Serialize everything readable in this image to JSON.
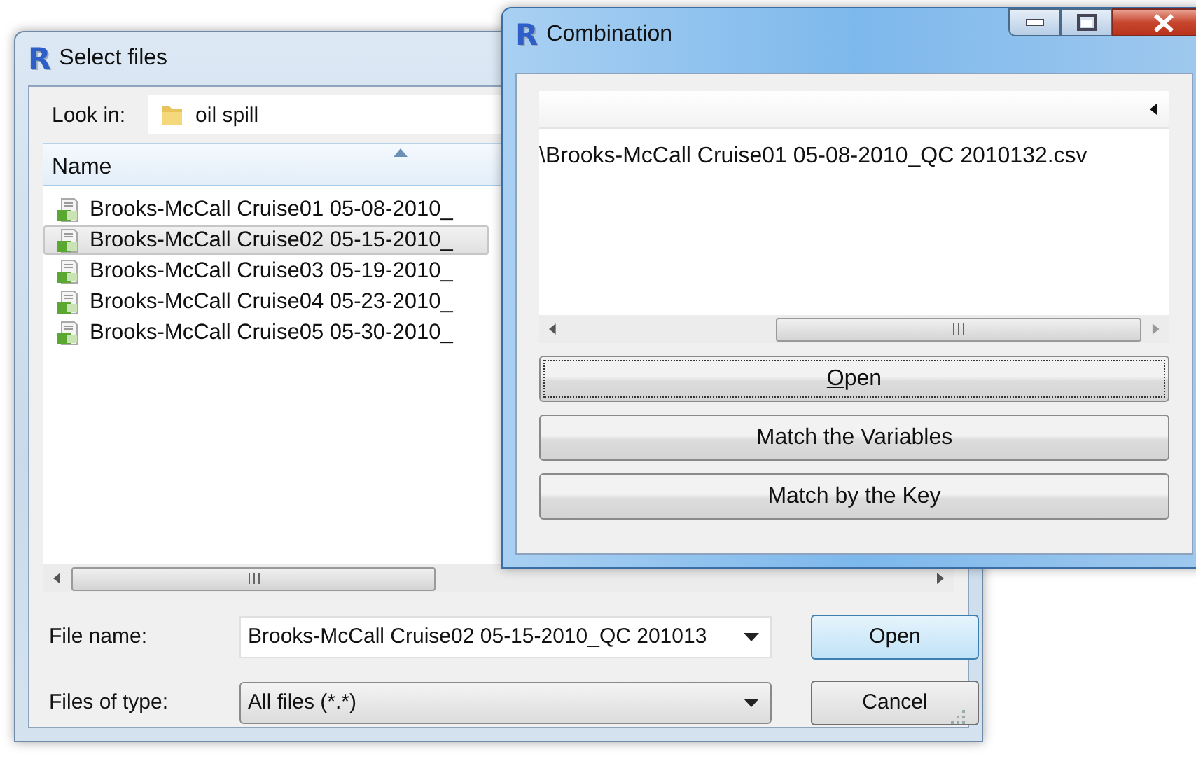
{
  "select_files": {
    "logo": "R",
    "title": "Select files",
    "look_in": {
      "label": "Look in:",
      "value": "oil spill"
    },
    "columns": [
      {
        "label": "Name",
        "sorted": true
      }
    ],
    "files": [
      {
        "name": "Brooks-McCall Cruise01 05-08-2010_",
        "selected": false
      },
      {
        "name": "Brooks-McCall Cruise02 05-15-2010_",
        "selected": true
      },
      {
        "name": "Brooks-McCall Cruise03 05-19-2010_",
        "selected": false
      },
      {
        "name": "Brooks-McCall Cruise04 05-23-2010_",
        "selected": false
      },
      {
        "name": "Brooks-McCall Cruise05 05-30-2010_",
        "selected": false
      }
    ],
    "file_name": {
      "label": "File name:",
      "value": "Brooks-McCall Cruise02 05-15-2010_QC 201013"
    },
    "file_type": {
      "label": "Files of type:",
      "value": "All files (*.*)"
    },
    "buttons": [
      {
        "label": "Open",
        "default": true
      },
      {
        "label": "Cancel",
        "default": false
      }
    ]
  },
  "combination": {
    "logo": "R",
    "title": "Combination",
    "path": "\\Brooks-McCall Cruise01 05-08-2010_QC 2010132.csv",
    "buttons": [
      {
        "label": "Open",
        "focused": true,
        "first_letter_underlined": true
      },
      {
        "label": "Match the Variables",
        "focused": false
      },
      {
        "label": "Match by the Key",
        "focused": false
      }
    ]
  }
}
